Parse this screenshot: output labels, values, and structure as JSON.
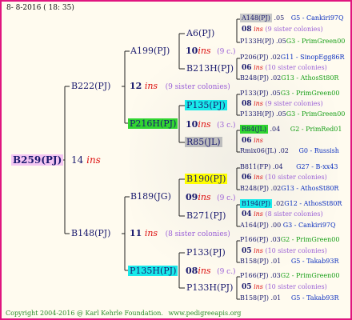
{
  "header": {
    "date": "8- 8-2016 ( 18: 35)"
  },
  "footer": {
    "copyright": "Copyright 2004-2016 @ Karl Kehrle Foundation.",
    "site": "www.pedigreeapis.org"
  },
  "root": {
    "name": "B259(PJ)",
    "num": "14",
    "ins": "ins"
  },
  "gen2": [
    {
      "name": "B222(PJ)"
    },
    {
      "name": "B148(PJ)"
    }
  ],
  "gen2_ins": [
    {
      "num": "12",
      "ins": "ins",
      "sisters": "(9 sister colonies)"
    },
    {
      "num": "11",
      "ins": "ins",
      "sisters": "(8 sister colonies)"
    }
  ],
  "gen3": [
    {
      "name": "A199(PJ)"
    },
    {
      "name": "P216H(PJ)"
    },
    {
      "name": "B189(JG)"
    },
    {
      "name": "P135H(PJ)"
    }
  ],
  "gen3_ins": [
    {
      "num": "10",
      "ins": "ins",
      "sisters": "(9 c.)"
    },
    {
      "num": "10",
      "ins": "ins",
      "sisters": "(3 c.)"
    },
    {
      "num": "09",
      "ins": "ins",
      "sisters": "(9 c.)"
    },
    {
      "num": "08",
      "ins": "ins",
      "sisters": "(9 c.)"
    }
  ],
  "gen4": [
    {
      "name": "A6(PJ)"
    },
    {
      "name": "B213H(PJ)"
    },
    {
      "name": "P135(PJ)"
    },
    {
      "name": "R85(JL)"
    },
    {
      "name": "B190(PJ)"
    },
    {
      "name": "B271(PJ)"
    },
    {
      "name": "P133(PJ)"
    },
    {
      "name": "P133H(PJ)"
    }
  ],
  "gen5": [
    {
      "top": "A148(PJ)",
      "top_val": ".05",
      "top_line": "G5 - Cankiri97Q",
      "num": "08",
      "ins": "ins",
      "sisters": "(9 sister colonies)",
      "bottom": "P133H(PJ)",
      "bottom_val": ".05",
      "bottom_line": "G3 - PrimGreen00"
    },
    {
      "top": "P206(PJ)",
      "top_val": ".02",
      "top_line": "G11 - SinopEgg86R",
      "num": "06",
      "ins": "ins",
      "sisters": "(10 sister colonies)",
      "bottom": "B248(PJ)",
      "bottom_val": ".02",
      "bottom_line": "G13 - AthosSt80R"
    },
    {
      "top": "P133(PJ)",
      "top_val": ".05",
      "top_line": "G3 - PrimGreen00",
      "num": "08",
      "ins": "ins",
      "sisters": "(9 sister colonies)",
      "bottom": "P133H(PJ)",
      "bottom_val": ".05",
      "bottom_line": "G3 - PrimGreen00"
    },
    {
      "top": "R84(JL)",
      "top_val": ".04",
      "top_line": "G2 - PrimRed01",
      "num": "06",
      "ins": "ins",
      "sisters": "",
      "bottom": "Rmix06(JL)",
      "bottom_val": ".02",
      "bottom_line": "G0 - Russish"
    },
    {
      "top": "B811(FP)",
      "top_val": ".04",
      "top_line": "G27 - B-xx43",
      "num": "06",
      "ins": "ins",
      "sisters": "(10 sister colonies)",
      "bottom": "B248(PJ)",
      "bottom_val": ".02",
      "bottom_line": "G13 - AthosSt80R"
    },
    {
      "top": "B194(PJ)",
      "top_val": ".02",
      "top_line": "G12 - AthosSt80R",
      "num": "04",
      "ins": "ins",
      "sisters": "(8 sister colonies)",
      "bottom": "A164(PJ)",
      "bottom_val": ".00",
      "bottom_line": "G3 - Cankiri97Q"
    },
    {
      "top": "P166(PJ)",
      "top_val": ".03",
      "top_line": "G2 - PrimGreen00",
      "num": "05",
      "ins": "ins",
      "sisters": "(10 sister colonies)",
      "bottom": "B158(PJ)",
      "bottom_val": ".01",
      "bottom_line": "G5 - Takab93R"
    },
    {
      "top": "P166(PJ)",
      "top_val": ".03",
      "top_line": "G2 - PrimGreen00",
      "num": "05",
      "ins": "ins",
      "sisters": "(10 sister colonies)",
      "bottom": "B158(PJ)",
      "bottom_val": ".01",
      "bottom_line": "G5 - Takab93R"
    }
  ]
}
